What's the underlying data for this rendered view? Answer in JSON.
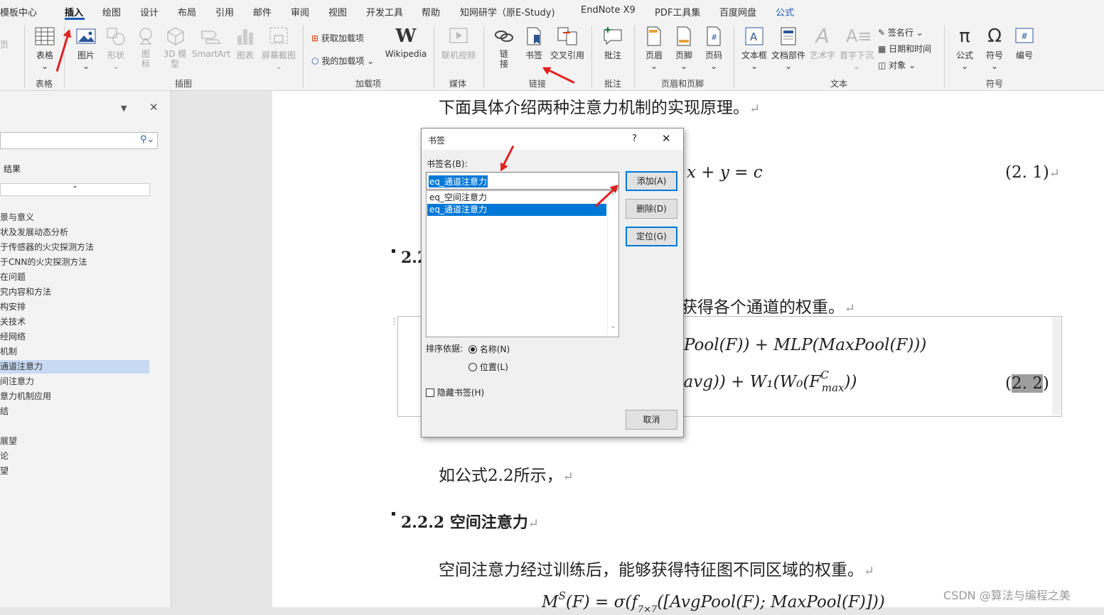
{
  "menu": {
    "tabs": [
      "模板中心",
      "插入",
      "绘图",
      "设计",
      "布局",
      "引用",
      "邮件",
      "审阅",
      "视图",
      "开发工具",
      "帮助",
      "知网研学（原E-Study)",
      "EndNote X9",
      "PDF工具集",
      "百度网盘",
      "公式"
    ],
    "active_tab": "插入"
  },
  "ribbon": {
    "left_cut": "页",
    "table": "表格",
    "picture": "图片",
    "shapes": "形状",
    "icons": "图标",
    "model3d": "3D 模型",
    "smartart": "SmartArt",
    "chart": "图表",
    "screenshot": "屏幕截图",
    "get_addins": "获取加载项",
    "my_addins": "我的加载项",
    "wikipedia": "Wikipedia",
    "online_video": "联机视频",
    "link": "链接",
    "bookmark": "书签",
    "cross_ref": "交叉引用",
    "comment": "批注",
    "header": "页眉",
    "footer": "页脚",
    "page_num": "页码",
    "textbox": "文本框",
    "quickparts": "文档部件",
    "wordart": "艺术字",
    "dropcap": "首字下沉",
    "signature": "签名行",
    "datetime": "日期和时间",
    "object": "对象",
    "equation": "公式",
    "symbol": "符号",
    "number": "编号",
    "groups": {
      "tables": "表格",
      "illustrations": "插图",
      "addins": "加载项",
      "media": "媒体",
      "links": "链接",
      "comments": "批注",
      "header_footer": "页眉和页脚",
      "text": "文本",
      "symbols": "符号"
    }
  },
  "nav": {
    "results_label": "结果",
    "items": [
      "景与意义",
      "状及发展动态分析",
      "于传感器的火灾探测方法",
      "于CNN的火灾探测方法",
      "在问题",
      "究内容和方法",
      "构安排",
      "关技术",
      "经网络",
      "机制",
      "通道注意力",
      "间注意力",
      "意力机制应用",
      "结",
      "",
      "展望",
      "论",
      "望"
    ],
    "selected": "通道注意力"
  },
  "document": {
    "intro": "下面具体介绍两种注意力机制的实现原理。",
    "eq1": "x + y = c",
    "eq1_num": "(2. 1)",
    "heading_221": "2.2",
    "channel_text": "获得各个通道的权重。",
    "eq2_line1": "Pool(F)) + MLP(MaxPool(F)))",
    "eq2_line2": "avg)) + W₁(W₀(F",
    "eq2_line2_sup": "C",
    "eq2_line2_sub": "max",
    "eq2_line2_end": "))",
    "eq2_line2_prefix_sup": "C",
    "eq2_num_open": "(",
    "eq2_num": "2. 2",
    "eq2_num_close": ")",
    "ref_text": "如公式2.2所示，",
    "heading_222": "2.2.2 空间注意力",
    "spatial_text": "空间注意力经过训练后，能够获得特征图不同区域的权重。",
    "eq3": "M",
    "eq3_rest": "(F) = σ(f",
    "eq3_tail": "([AvgPool(F); MaxPool(F)]))",
    "eq3_sup": "S",
    "eq3_sub": "7×7"
  },
  "dialog": {
    "title": "书签",
    "help": "?",
    "close": "✕",
    "name_label": "书签名(B):",
    "name_value": "eq_通道注意力",
    "list": [
      "eq_空间注意力",
      "eq_通道注意力"
    ],
    "selected": "eq_通道注意力",
    "add": "添加(A)",
    "delete": "删除(D)",
    "goto": "定位(G)",
    "sort_label": "排序依据:",
    "sort_name": "名称(N)",
    "sort_position": "位置(L)",
    "hide": "隐藏书签(H)",
    "cancel": "取消"
  },
  "watermark": "CSDN @算法与编程之美",
  "colors": {
    "accent": "#185abd",
    "selection": "#0078d7",
    "arrow": "#e02020"
  }
}
